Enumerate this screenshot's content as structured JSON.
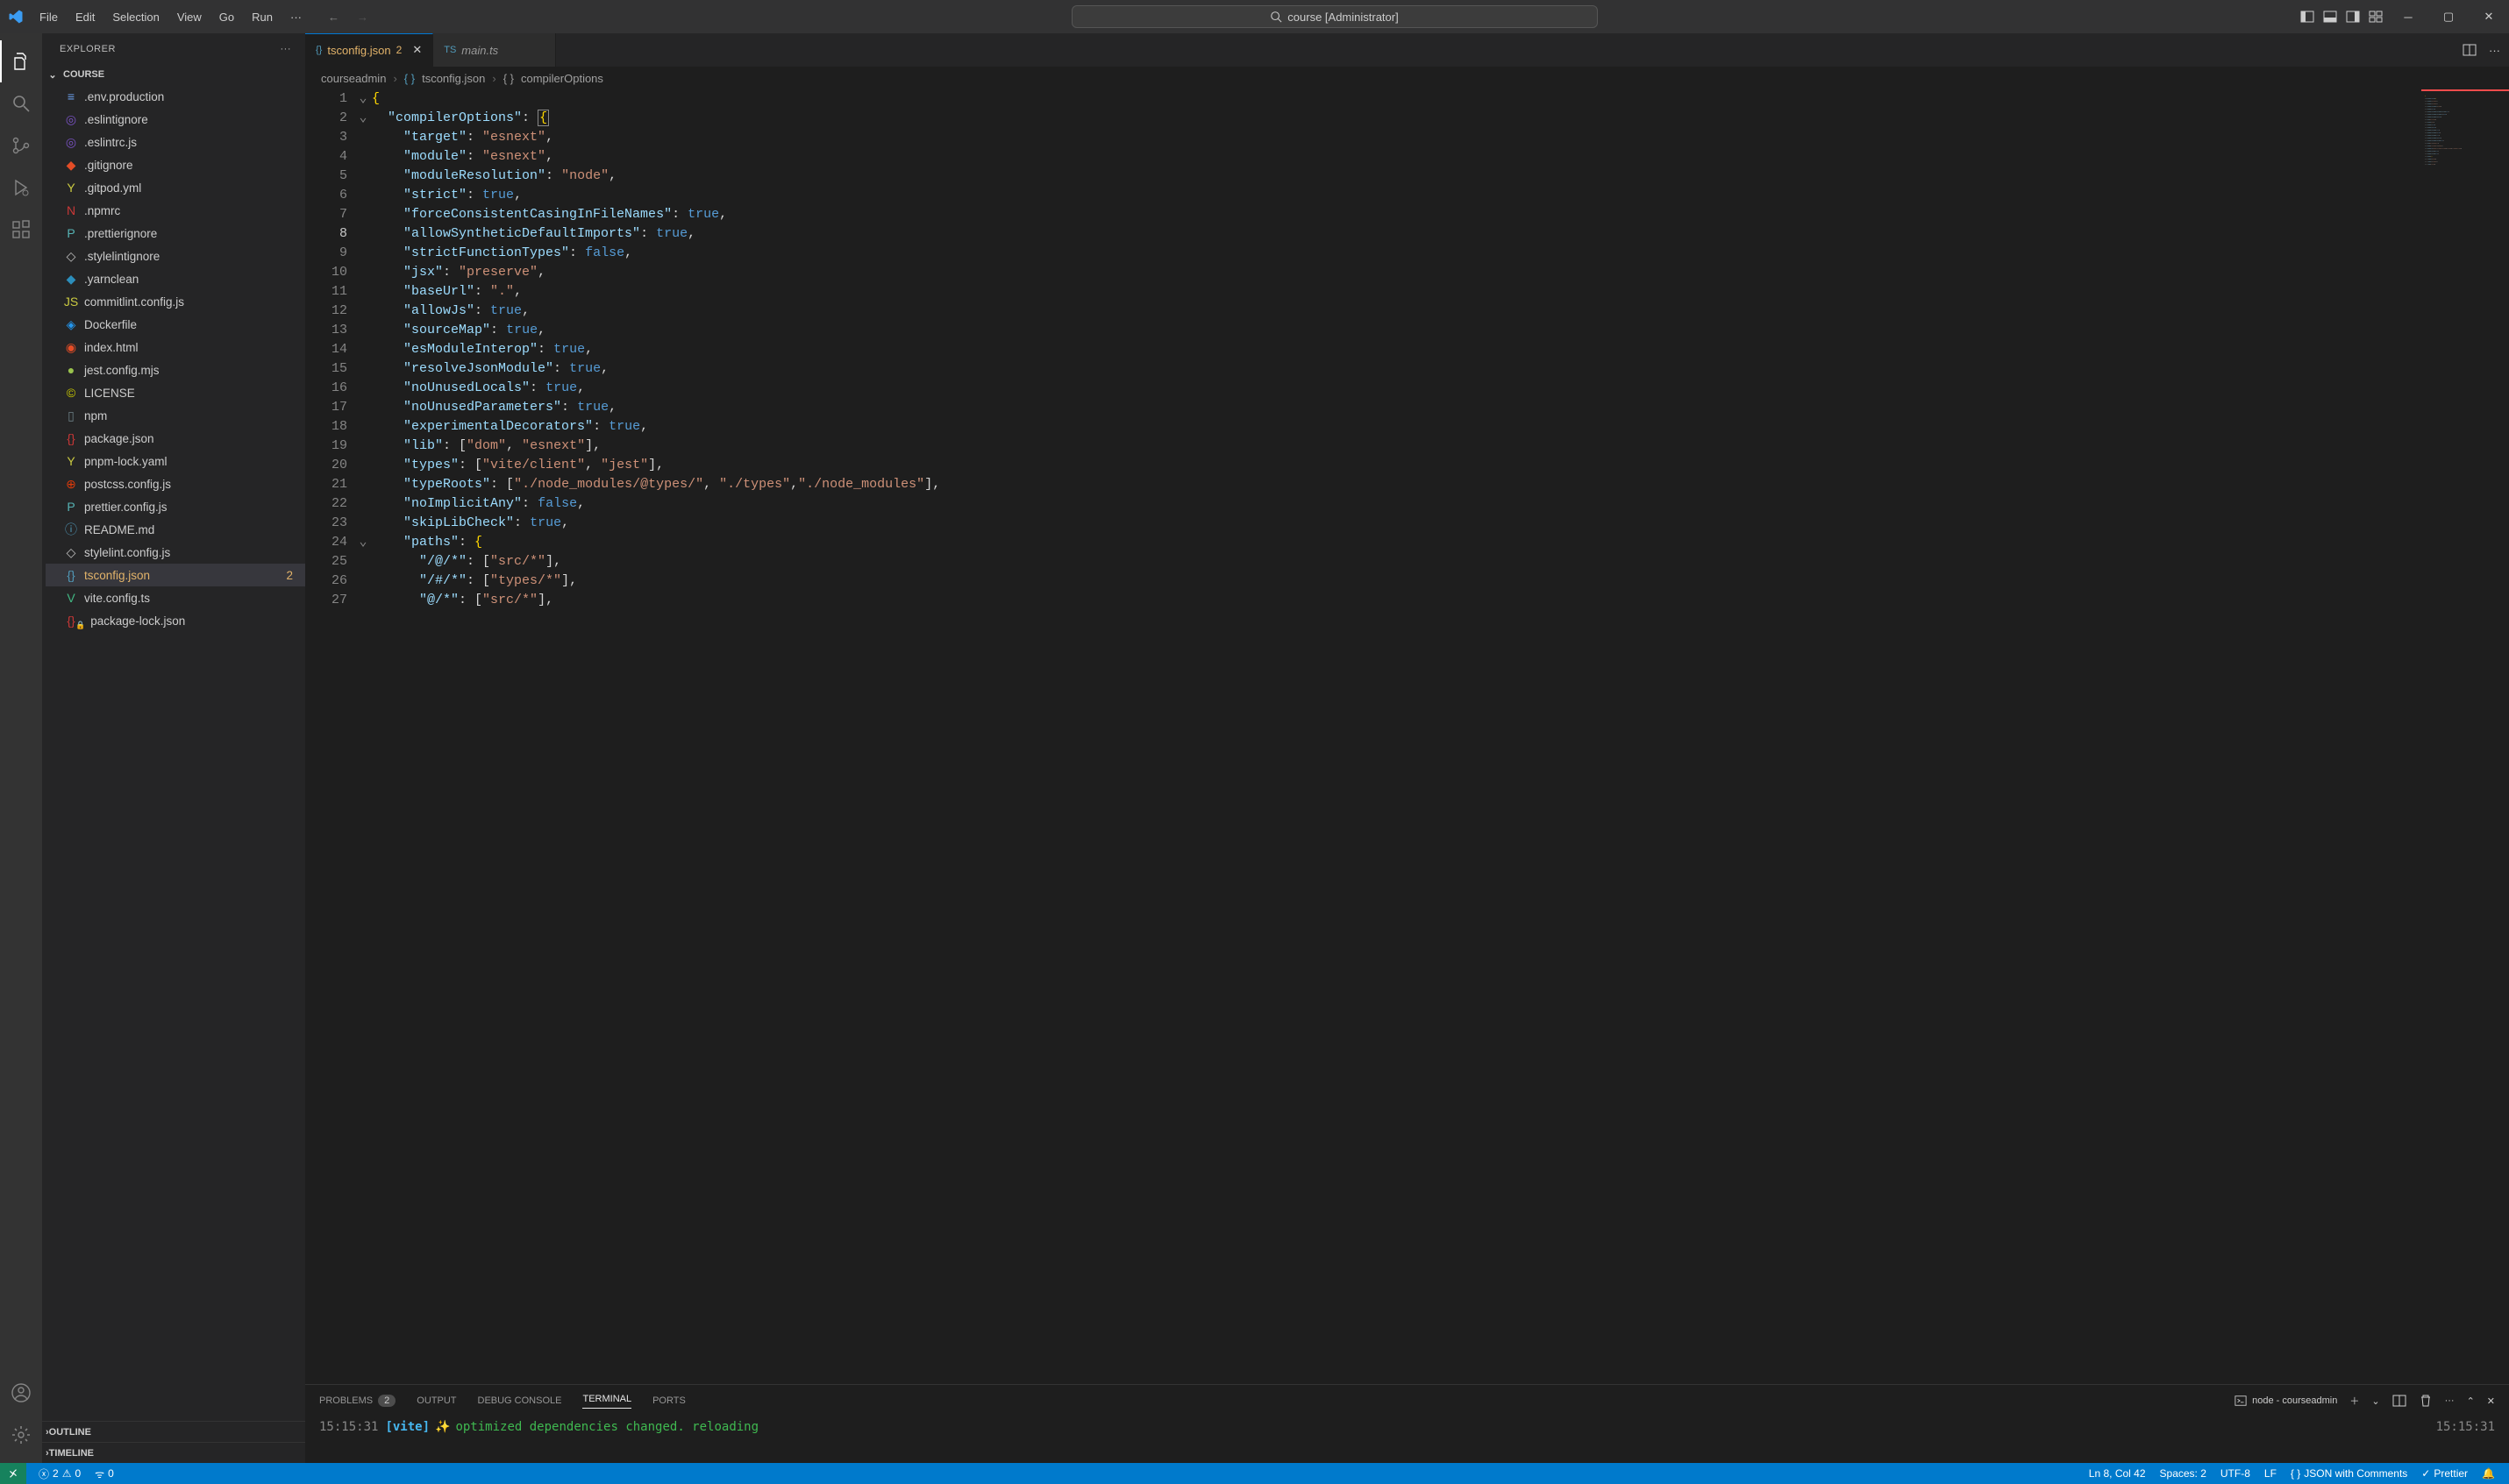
{
  "titlebar": {
    "menu": [
      "File",
      "Edit",
      "Selection",
      "View",
      "Go",
      "Run"
    ],
    "search_text": "course [Administrator]"
  },
  "sidebar": {
    "title": "EXPLORER",
    "section": "COURSE",
    "outline": "OUTLINE",
    "timeline": "TIMELINE",
    "files": [
      {
        "name": ".env.production",
        "iconColor": "#6aa0ec",
        "glyph": "≡"
      },
      {
        "name": ".eslintignore",
        "iconColor": "#7a52c4",
        "glyph": "◎"
      },
      {
        "name": ".eslintrc.js",
        "iconColor": "#7a52c4",
        "glyph": "◎"
      },
      {
        "name": ".gitignore",
        "iconColor": "#e44d26",
        "glyph": "◆"
      },
      {
        "name": ".gitpod.yml",
        "iconColor": "#cbcb41",
        "glyph": "Y"
      },
      {
        "name": ".npmrc",
        "iconColor": "#cb3837",
        "glyph": "N"
      },
      {
        "name": ".prettierignore",
        "iconColor": "#56b3b4",
        "glyph": "P"
      },
      {
        "name": ".stylelintignore",
        "iconColor": "#c0c0c0",
        "glyph": "◇"
      },
      {
        "name": ".yarnclean",
        "iconColor": "#2c8ebb",
        "glyph": "◆"
      },
      {
        "name": "commitlint.config.js",
        "iconColor": "#cbcb41",
        "glyph": "JS"
      },
      {
        "name": "Dockerfile",
        "iconColor": "#2496ed",
        "glyph": "◈"
      },
      {
        "name": "index.html",
        "iconColor": "#e44d26",
        "glyph": "◉"
      },
      {
        "name": "jest.config.mjs",
        "iconColor": "#99c24d",
        "glyph": "●"
      },
      {
        "name": "LICENSE",
        "iconColor": "#cccc00",
        "glyph": "©"
      },
      {
        "name": "npm",
        "iconColor": "#6d8086",
        "glyph": "▯"
      },
      {
        "name": "package.json",
        "iconColor": "#cb3837",
        "glyph": "{}"
      },
      {
        "name": "pnpm-lock.yaml",
        "iconColor": "#cbcb41",
        "glyph": "Y"
      },
      {
        "name": "postcss.config.js",
        "iconColor": "#dd3a0a",
        "glyph": "⊕"
      },
      {
        "name": "prettier.config.js",
        "iconColor": "#56b3b4",
        "glyph": "P"
      },
      {
        "name": "README.md",
        "iconColor": "#519aba",
        "glyph": "ⓘ"
      },
      {
        "name": "stylelint.config.js",
        "iconColor": "#c0c0c0",
        "glyph": "◇"
      },
      {
        "name": "tsconfig.json",
        "iconColor": "#519aba",
        "glyph": "{}",
        "active": true,
        "badge": "2"
      },
      {
        "name": "vite.config.ts",
        "iconColor": "#41b883",
        "glyph": "V"
      },
      {
        "name": "package-lock.json",
        "iconColor": "#cb3837",
        "glyph": "{}",
        "locked": true
      }
    ]
  },
  "tabs": [
    {
      "label": "tsconfig.json",
      "badge": "2",
      "active": true,
      "icon": "{}",
      "iconColor": "#519aba"
    },
    {
      "label": "main.ts",
      "inactive": true,
      "icon": "TS",
      "iconColor": "#519aba"
    }
  ],
  "breadcrumbs": {
    "root": "courseadmin",
    "file": "tsconfig.json",
    "symbol": "compilerOptions"
  },
  "code_lines": [
    {
      "n": 1,
      "fold": "⌄",
      "tokens": [
        [
          "brace",
          "{"
        ]
      ]
    },
    {
      "n": 2,
      "fold": "⌄",
      "tokens": [
        [
          "",
          "  "
        ],
        [
          "key",
          "\"compilerOptions\""
        ],
        [
          "punct",
          ": "
        ],
        [
          "brace",
          "{"
        ]
      ],
      "hl_brace": true
    },
    {
      "n": 3,
      "tokens": [
        [
          "",
          "    "
        ],
        [
          "key",
          "\"target\""
        ],
        [
          "punct",
          ": "
        ],
        [
          "str",
          "\"esnext\""
        ],
        [
          "punct",
          ","
        ]
      ]
    },
    {
      "n": 4,
      "tokens": [
        [
          "",
          "    "
        ],
        [
          "key",
          "\"module\""
        ],
        [
          "punct",
          ": "
        ],
        [
          "str",
          "\"esnext\""
        ],
        [
          "punct",
          ","
        ]
      ]
    },
    {
      "n": 5,
      "tokens": [
        [
          "",
          "    "
        ],
        [
          "key",
          "\"moduleResolution\""
        ],
        [
          "punct",
          ": "
        ],
        [
          "str",
          "\"node\""
        ],
        [
          "punct",
          ","
        ]
      ]
    },
    {
      "n": 6,
      "tokens": [
        [
          "",
          "    "
        ],
        [
          "key",
          "\"strict\""
        ],
        [
          "punct",
          ": "
        ],
        [
          "bool",
          "true"
        ],
        [
          "punct",
          ","
        ]
      ]
    },
    {
      "n": 7,
      "tokens": [
        [
          "",
          "    "
        ],
        [
          "key",
          "\"forceConsistentCasingInFileNames\""
        ],
        [
          "punct",
          ": "
        ],
        [
          "bool",
          "true"
        ],
        [
          "punct",
          ","
        ]
      ]
    },
    {
      "n": 8,
      "current": true,
      "tokens": [
        [
          "",
          "    "
        ],
        [
          "key",
          "\"allowSyntheticDefaultImports\""
        ],
        [
          "punct",
          ": "
        ],
        [
          "bool",
          "true"
        ],
        [
          "punct",
          ","
        ]
      ]
    },
    {
      "n": 9,
      "tokens": [
        [
          "",
          "    "
        ],
        [
          "key",
          "\"strictFunctionTypes\""
        ],
        [
          "punct",
          ": "
        ],
        [
          "bool",
          "false"
        ],
        [
          "punct",
          ","
        ]
      ]
    },
    {
      "n": 10,
      "tokens": [
        [
          "",
          "    "
        ],
        [
          "key",
          "\"jsx\""
        ],
        [
          "punct",
          ": "
        ],
        [
          "str",
          "\"preserve\""
        ],
        [
          "punct",
          ","
        ]
      ]
    },
    {
      "n": 11,
      "tokens": [
        [
          "",
          "    "
        ],
        [
          "key",
          "\"baseUrl\""
        ],
        [
          "punct",
          ": "
        ],
        [
          "str",
          "\".\""
        ],
        [
          "punct",
          ","
        ]
      ]
    },
    {
      "n": 12,
      "tokens": [
        [
          "",
          "    "
        ],
        [
          "key",
          "\"allowJs\""
        ],
        [
          "punct",
          ": "
        ],
        [
          "bool",
          "true"
        ],
        [
          "punct",
          ","
        ]
      ]
    },
    {
      "n": 13,
      "tokens": [
        [
          "",
          "    "
        ],
        [
          "key",
          "\"sourceMap\""
        ],
        [
          "punct",
          ": "
        ],
        [
          "bool",
          "true"
        ],
        [
          "punct",
          ","
        ]
      ]
    },
    {
      "n": 14,
      "tokens": [
        [
          "",
          "    "
        ],
        [
          "key",
          "\"esModuleInterop\""
        ],
        [
          "punct",
          ": "
        ],
        [
          "bool",
          "true"
        ],
        [
          "punct",
          ","
        ]
      ]
    },
    {
      "n": 15,
      "tokens": [
        [
          "",
          "    "
        ],
        [
          "key",
          "\"resolveJsonModule\""
        ],
        [
          "punct",
          ": "
        ],
        [
          "bool",
          "true"
        ],
        [
          "punct",
          ","
        ]
      ]
    },
    {
      "n": 16,
      "tokens": [
        [
          "",
          "    "
        ],
        [
          "key",
          "\"noUnusedLocals\""
        ],
        [
          "punct",
          ": "
        ],
        [
          "bool",
          "true"
        ],
        [
          "punct",
          ","
        ]
      ]
    },
    {
      "n": 17,
      "tokens": [
        [
          "",
          "    "
        ],
        [
          "key",
          "\"noUnusedParameters\""
        ],
        [
          "punct",
          ": "
        ],
        [
          "bool",
          "true"
        ],
        [
          "punct",
          ","
        ]
      ]
    },
    {
      "n": 18,
      "tokens": [
        [
          "",
          "    "
        ],
        [
          "key",
          "\"experimentalDecorators\""
        ],
        [
          "punct",
          ": "
        ],
        [
          "bool",
          "true"
        ],
        [
          "punct",
          ","
        ]
      ]
    },
    {
      "n": 19,
      "tokens": [
        [
          "",
          "    "
        ],
        [
          "key",
          "\"lib\""
        ],
        [
          "punct",
          ": ["
        ],
        [
          "str",
          "\"dom\""
        ],
        [
          "punct",
          ", "
        ],
        [
          "str",
          "\"esnext\""
        ],
        [
          "punct",
          "],"
        ]
      ]
    },
    {
      "n": 20,
      "tokens": [
        [
          "",
          "    "
        ],
        [
          "key",
          "\"types\""
        ],
        [
          "punct",
          ": ["
        ],
        [
          "str",
          "\"vite/client\""
        ],
        [
          "punct",
          ", "
        ],
        [
          "str",
          "\"jest\""
        ],
        [
          "punct",
          "],"
        ]
      ]
    },
    {
      "n": 21,
      "tokens": [
        [
          "",
          "    "
        ],
        [
          "key",
          "\"typeRoots\""
        ],
        [
          "punct",
          ": ["
        ],
        [
          "str",
          "\"./node_modules/@types/\""
        ],
        [
          "punct",
          ", "
        ],
        [
          "str",
          "\"./types\""
        ],
        [
          "punct",
          ","
        ],
        [
          "str",
          "\"./node_modules\""
        ],
        [
          "punct",
          "],"
        ]
      ]
    },
    {
      "n": 22,
      "tokens": [
        [
          "",
          "    "
        ],
        [
          "key",
          "\"noImplicitAny\""
        ],
        [
          "punct",
          ": "
        ],
        [
          "bool",
          "false"
        ],
        [
          "punct",
          ","
        ]
      ]
    },
    {
      "n": 23,
      "tokens": [
        [
          "",
          "    "
        ],
        [
          "key",
          "\"skipLibCheck\""
        ],
        [
          "punct",
          ": "
        ],
        [
          "bool",
          "true"
        ],
        [
          "punct",
          ","
        ]
      ]
    },
    {
      "n": 24,
      "fold": "⌄",
      "tokens": [
        [
          "",
          "    "
        ],
        [
          "key",
          "\"paths\""
        ],
        [
          "punct",
          ": "
        ],
        [
          "brace",
          "{"
        ]
      ]
    },
    {
      "n": 25,
      "tokens": [
        [
          "",
          "      "
        ],
        [
          "key",
          "\"/@/*\""
        ],
        [
          "punct",
          ": ["
        ],
        [
          "str",
          "\"src/*\""
        ],
        [
          "punct",
          "],"
        ]
      ]
    },
    {
      "n": 26,
      "tokens": [
        [
          "",
          "      "
        ],
        [
          "key",
          "\"/#/*\""
        ],
        [
          "punct",
          ": ["
        ],
        [
          "str",
          "\"types/*\""
        ],
        [
          "punct",
          "],"
        ]
      ]
    },
    {
      "n": 27,
      "tokens": [
        [
          "",
          "      "
        ],
        [
          "key",
          "\"@/*\""
        ],
        [
          "punct",
          ": ["
        ],
        [
          "str",
          "\"src/*\""
        ],
        [
          "punct",
          "],"
        ]
      ]
    }
  ],
  "panel": {
    "tabs": {
      "problems": "PROBLEMS",
      "problems_count": "2",
      "output": "OUTPUT",
      "debug": "DEBUG CONSOLE",
      "terminal": "TERMINAL",
      "ports": "PORTS"
    },
    "term_session": "node - courseadmin",
    "term_time": "15:15:31",
    "term_tag": "[vite]",
    "term_msg": "optimized dependencies changed. reloading",
    "term_right_time": "15:15:31"
  },
  "statusbar": {
    "errors": "2",
    "warnings": "0",
    "port": "0",
    "cursor": "Ln 8, Col 42",
    "spaces": "Spaces: 2",
    "encoding": "UTF-8",
    "eol": "LF",
    "language": "JSON with Comments",
    "prettier": "Prettier"
  }
}
